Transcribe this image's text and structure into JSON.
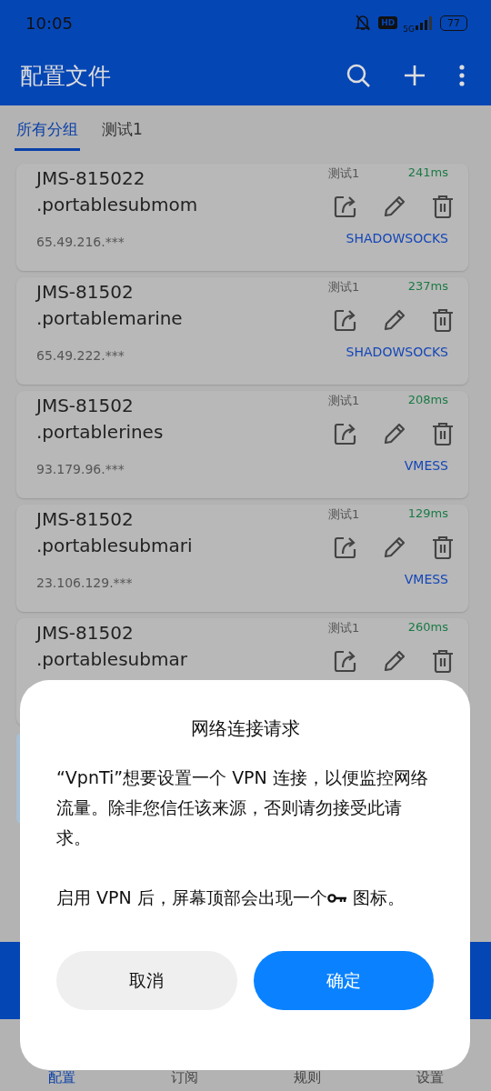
{
  "status_bar": {
    "time": "10:05",
    "hd": "HD",
    "network": "5G",
    "battery": "77"
  },
  "app_bar": {
    "title": "配置文件"
  },
  "tabs": [
    {
      "label": "所有分组",
      "selected": true
    },
    {
      "label": "测试1",
      "selected": false
    }
  ],
  "profiles": [
    {
      "name": "JMS-815022",
      "host": ".portablesubmom",
      "group": "测试1",
      "latency": "241ms",
      "address": "65.49.216.***",
      "type": "SHADOWSOCKS"
    },
    {
      "name": "JMS-81502",
      "host": ".portablemarine",
      "group": "测试1",
      "latency": "237ms",
      "address": "65.49.222.***",
      "type": "SHADOWSOCKS"
    },
    {
      "name": "JMS-81502",
      "host": ".portablerines",
      "group": "测试1",
      "latency": "208ms",
      "address": "93.179.96.***",
      "type": "VMESS"
    },
    {
      "name": "JMS-81502",
      "host": ".portablesubmari",
      "group": "测试1",
      "latency": "129ms",
      "address": "23.106.129.***",
      "type": "VMESS"
    },
    {
      "name": "JMS-81502",
      "host": ".portablesubmar",
      "group": "测试1",
      "latency": "260ms"
    }
  ],
  "bottom_nav": [
    {
      "label": "配置",
      "selected": true
    },
    {
      "label": "订阅",
      "selected": false
    },
    {
      "label": "规则",
      "selected": false
    },
    {
      "label": "设置",
      "selected": false
    }
  ],
  "dialog": {
    "title": "网络连接请求",
    "message": "“VpnTi”想要设置一个 VPN 连接，以便监控网络流量。除非您信任该来源，否则请勿接受此请求。",
    "note_before": "启用 VPN 后，屏幕顶部会出现一个",
    "note_after": "图标。",
    "buttons": [
      {
        "label": "取消",
        "kind": "cancel"
      },
      {
        "label": "确定",
        "kind": "confirm"
      }
    ]
  }
}
